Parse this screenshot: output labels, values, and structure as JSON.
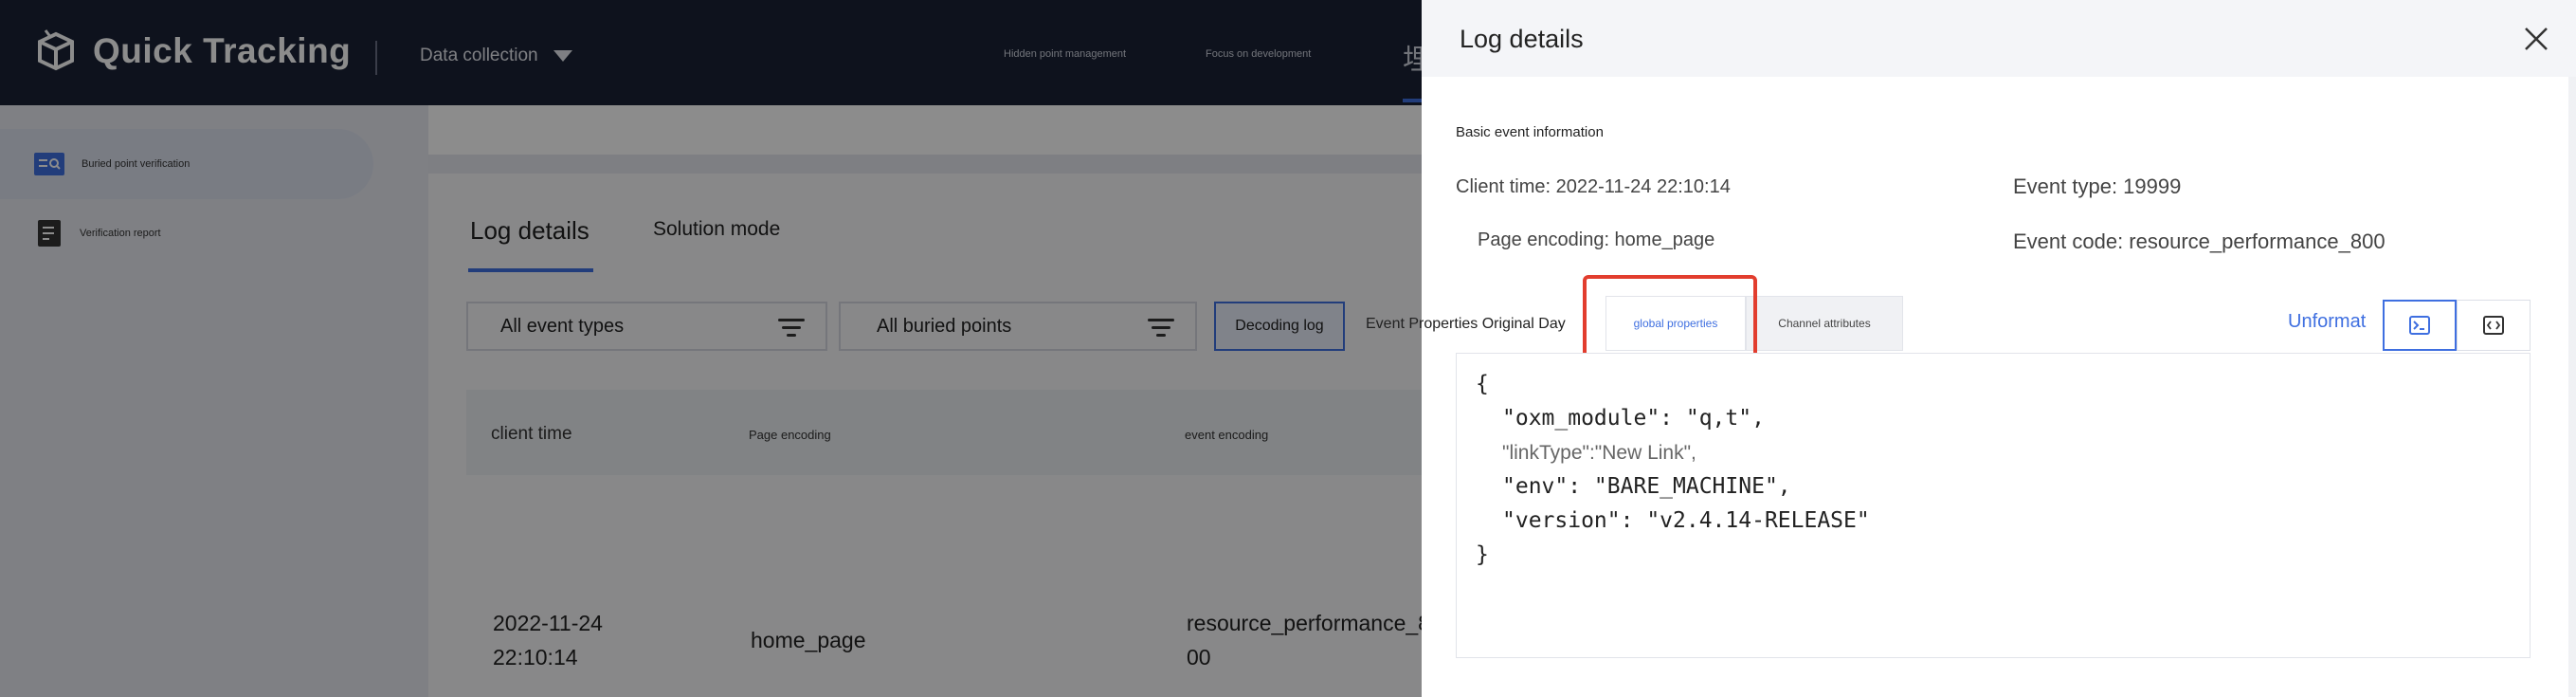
{
  "app": {
    "name": "Quick Tracking"
  },
  "topnav": {
    "data_collection": "Data collection",
    "hidden_point_management": "Hidden point management",
    "focus_on_development": "Focus on development",
    "cjk_item": "埋"
  },
  "sidebar": {
    "items": [
      {
        "label": "Buried point verification",
        "icon": "search-list-icon",
        "active": true
      },
      {
        "label": "Verification report",
        "icon": "report-icon",
        "active": false
      }
    ]
  },
  "main": {
    "tabs": [
      {
        "label": "Log details"
      },
      {
        "label": "Solution mode"
      }
    ],
    "filters": {
      "event_types": "All event types",
      "buried_points": "All buried points",
      "decoding_log": "Decoding log",
      "event_properties": "Event Properties Original Day"
    },
    "table": {
      "headers": [
        "client time",
        "Page encoding",
        "event encoding"
      ],
      "row": {
        "date": "2022-11-24",
        "time": "22:10:14",
        "page": "home_page",
        "event_line1": "resource_performance_8",
        "event_line2": "00"
      }
    }
  },
  "drawer": {
    "title": "Log details",
    "section": "Basic event information",
    "client_time": "Client time: 2022-11-24 22:10:14",
    "event_type": "Event type: 19999",
    "page_encoding": "Page encoding: home_page",
    "event_code": "Event code: resource_performance_800",
    "tabs": {
      "original": "Event Properties Original Day",
      "global": "global properties",
      "channel": "Channel attributes"
    },
    "unformat": "Unformat",
    "code": {
      "open": "{",
      "line1": "\"oxm_module\": \"q,t\",",
      "line2": "\"linkType\":\"New Link\",",
      "line3": "\"env\": \"BARE_MACHINE\",",
      "line4": "\"version\": \"v2.4.14-RELEASE\"",
      "close": "}"
    }
  },
  "colors": {
    "accent": "#3f6fe0",
    "highlight": "#e23d2e",
    "topbar": "#1a2236"
  }
}
